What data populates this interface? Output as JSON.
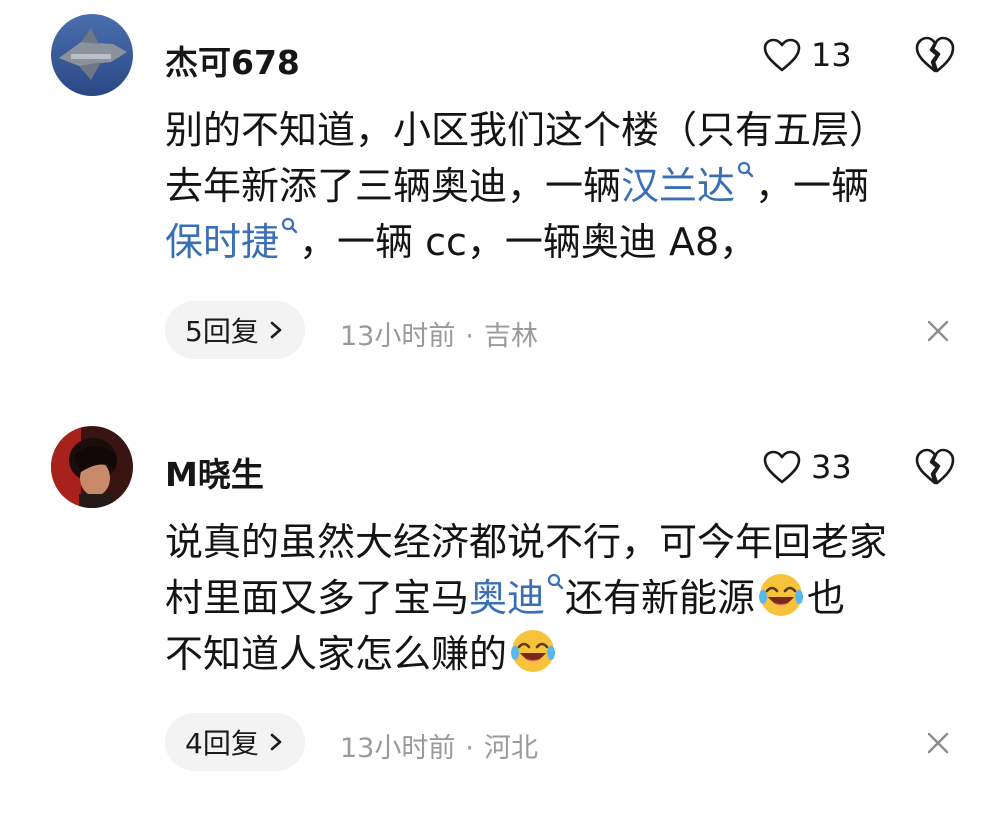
{
  "comments": [
    {
      "username": "杰可678",
      "like_count": "13",
      "text": {
        "line1": "别的不知道，小区我们这个楼（只有五层）",
        "line2_a": "去年新添了三辆奥迪，一辆",
        "line2_link": "汉兰达",
        "line2_b": "，一辆",
        "line3_link": "保时捷",
        "line3_b": "，一辆 cc，一辆奥迪 A8，"
      },
      "replies_label": "5回复",
      "time": "13小时前",
      "separator": "·",
      "location": "吉林"
    },
    {
      "username": "M晓生",
      "like_count": "33",
      "text": {
        "line1": "说真的虽然大经济都说不行，可今年回老家",
        "line2_a": "村里面又多了宝马",
        "line2_link": "奥迪",
        "line2_b": "还有新能源",
        "line2_c": "也",
        "line3": "不知道人家怎么赚的"
      },
      "replies_label": "4回复",
      "time": "13小时前",
      "separator": "·",
      "location": "河北"
    }
  ],
  "icons": {
    "like": "heart-outline-icon",
    "dislike": "broken-heart-icon",
    "keyword_search": "search-icon",
    "reply_chevron": "chevron-right-icon",
    "close": "close-icon",
    "emoji": "laughing-crying-emoji"
  },
  "colors": {
    "link": "#3a6fb5",
    "meta_text": "#9a9a9a",
    "pill_bg": "#f3f3f3"
  }
}
